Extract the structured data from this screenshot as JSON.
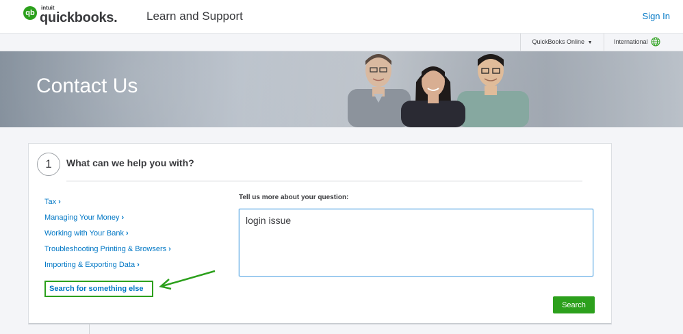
{
  "header": {
    "logo_mark": "qb",
    "logo_intuit": "intuit",
    "logo_word": "quickbooks.",
    "title": "Learn and Support",
    "sign_in": "Sign In"
  },
  "subbar": {
    "product": "QuickBooks Online",
    "international": "International"
  },
  "hero": {
    "title": "Contact Us"
  },
  "help": {
    "step_number": "1",
    "title": "What can we help you with?",
    "topics": [
      "Tax",
      "Managing Your Money",
      "Working with Your Bank",
      "Troubleshooting Printing & Browsers",
      "Importing & Exporting Data"
    ],
    "search_else": "Search for something else",
    "question_label": "Tell us more about your question:",
    "question_value": "login issue",
    "search_button": "Search"
  },
  "colors": {
    "brand_green": "#2ca01c",
    "link_blue": "#0077c5",
    "text_dark": "#393a3d"
  }
}
